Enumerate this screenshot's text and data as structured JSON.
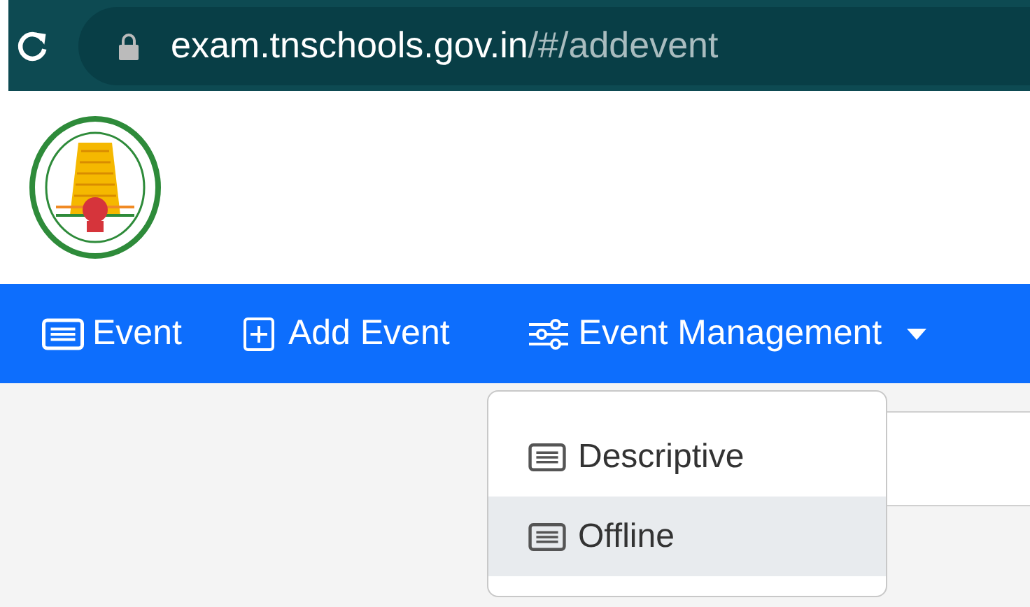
{
  "address_bar": {
    "host": "exam.tnschools.gov.in",
    "path": "/#/addevent"
  },
  "nav": {
    "items": [
      {
        "label": "Event",
        "kind": "list",
        "expanded": false
      },
      {
        "label": "Add Event",
        "kind": "add",
        "expanded": false
      },
      {
        "label": "Event Management",
        "kind": "sliders",
        "expanded": true
      }
    ]
  },
  "dropdown": {
    "items": [
      {
        "label": "Descriptive",
        "selected": false
      },
      {
        "label": "Offline",
        "selected": true
      }
    ]
  }
}
